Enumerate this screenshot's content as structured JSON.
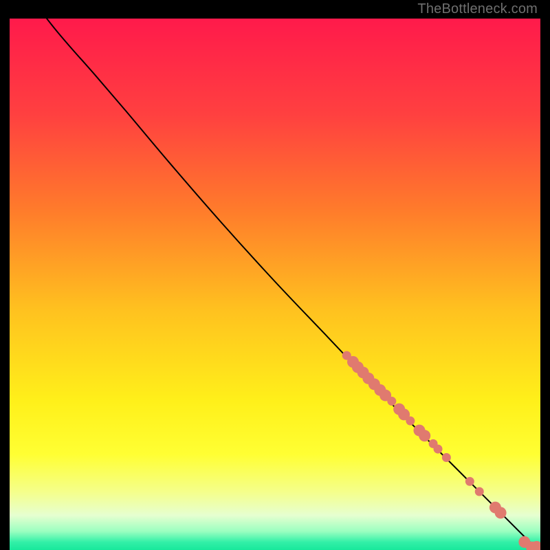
{
  "attribution": "TheBottleneck.com",
  "chart_data": {
    "type": "scatter",
    "title": "",
    "xlabel": "",
    "ylabel": "",
    "xlim": [
      0,
      100
    ],
    "ylim": [
      0,
      100
    ],
    "grid": false,
    "legend": false,
    "background": {
      "type": "vertical-gradient",
      "stops": [
        {
          "pos": 0.0,
          "color": "#ff1a4b"
        },
        {
          "pos": 0.18,
          "color": "#ff4040"
        },
        {
          "pos": 0.36,
          "color": "#ff7b2b"
        },
        {
          "pos": 0.55,
          "color": "#ffc21f"
        },
        {
          "pos": 0.72,
          "color": "#fff01a"
        },
        {
          "pos": 0.82,
          "color": "#ffff33"
        },
        {
          "pos": 0.89,
          "color": "#f5ff8a"
        },
        {
          "pos": 0.935,
          "color": "#e6ffd0"
        },
        {
          "pos": 0.965,
          "color": "#9affc0"
        },
        {
          "pos": 0.985,
          "color": "#33f0a8"
        },
        {
          "pos": 1.0,
          "color": "#18e89b"
        }
      ]
    },
    "curve": {
      "color": "#000000",
      "width": 2,
      "points": [
        {
          "x": 7.0,
          "y": 100.0
        },
        {
          "x": 9.0,
          "y": 97.5
        },
        {
          "x": 12.0,
          "y": 94.0
        },
        {
          "x": 16.0,
          "y": 89.5
        },
        {
          "x": 22.0,
          "y": 82.5
        },
        {
          "x": 30.0,
          "y": 73.0
        },
        {
          "x": 40.0,
          "y": 61.5
        },
        {
          "x": 50.0,
          "y": 50.5
        },
        {
          "x": 60.0,
          "y": 40.0
        },
        {
          "x": 70.0,
          "y": 29.5
        },
        {
          "x": 80.0,
          "y": 19.5
        },
        {
          "x": 90.0,
          "y": 9.5
        },
        {
          "x": 99.5,
          "y": 0.0
        }
      ]
    },
    "scatter": {
      "color": "#e07a6f",
      "radius_small": 6.5,
      "radius_large": 8.5,
      "points": [
        {
          "x": 63.5,
          "y": 36.6,
          "r": "small"
        },
        {
          "x": 64.7,
          "y": 35.4,
          "r": "large"
        },
        {
          "x": 65.6,
          "y": 34.4,
          "r": "large"
        },
        {
          "x": 66.6,
          "y": 33.4,
          "r": "large"
        },
        {
          "x": 67.6,
          "y": 32.3,
          "r": "large"
        },
        {
          "x": 68.7,
          "y": 31.2,
          "r": "large"
        },
        {
          "x": 69.8,
          "y": 30.1,
          "r": "large"
        },
        {
          "x": 70.8,
          "y": 29.1,
          "r": "large"
        },
        {
          "x": 72.0,
          "y": 28.0,
          "r": "small"
        },
        {
          "x": 73.4,
          "y": 26.5,
          "r": "large"
        },
        {
          "x": 74.3,
          "y": 25.5,
          "r": "large"
        },
        {
          "x": 75.5,
          "y": 24.3,
          "r": "small"
        },
        {
          "x": 77.2,
          "y": 22.5,
          "r": "large"
        },
        {
          "x": 78.2,
          "y": 21.5,
          "r": "large"
        },
        {
          "x": 79.8,
          "y": 20.0,
          "r": "small"
        },
        {
          "x": 80.7,
          "y": 19.0,
          "r": "small"
        },
        {
          "x": 82.3,
          "y": 17.4,
          "r": "small"
        },
        {
          "x": 86.7,
          "y": 12.9,
          "r": "small"
        },
        {
          "x": 88.5,
          "y": 11.0,
          "r": "small"
        },
        {
          "x": 91.5,
          "y": 8.0,
          "r": "large"
        },
        {
          "x": 92.5,
          "y": 7.0,
          "r": "large"
        },
        {
          "x": 97.0,
          "y": 1.5,
          "r": "large"
        },
        {
          "x": 98.4,
          "y": 0.5,
          "r": "large"
        },
        {
          "x": 99.3,
          "y": 0.6,
          "r": "large"
        }
      ]
    }
  }
}
